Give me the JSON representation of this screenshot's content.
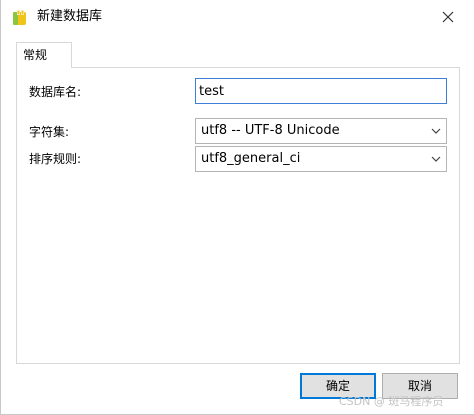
{
  "window": {
    "title": "新建数据库",
    "icon": "database-icon",
    "close_icon": "close-icon"
  },
  "tabs": [
    {
      "label": "常规",
      "active": true
    }
  ],
  "form": {
    "db_name_label": "数据库名:",
    "db_name_value": "test",
    "charset_label": "字符集:",
    "charset_value": "utf8 -- UTF-8 Unicode",
    "collation_label": "排序规则:",
    "collation_value": "utf8_general_ci"
  },
  "buttons": {
    "ok_label": "确定",
    "cancel_label": "取消"
  },
  "watermark": "CSDN @ 斑马程序员",
  "colors": {
    "input_focus_border": "#3c7fd6",
    "default_button_border": "#0078d7",
    "icon_yellow": "#f0c419",
    "icon_green": "#8cc63f"
  }
}
